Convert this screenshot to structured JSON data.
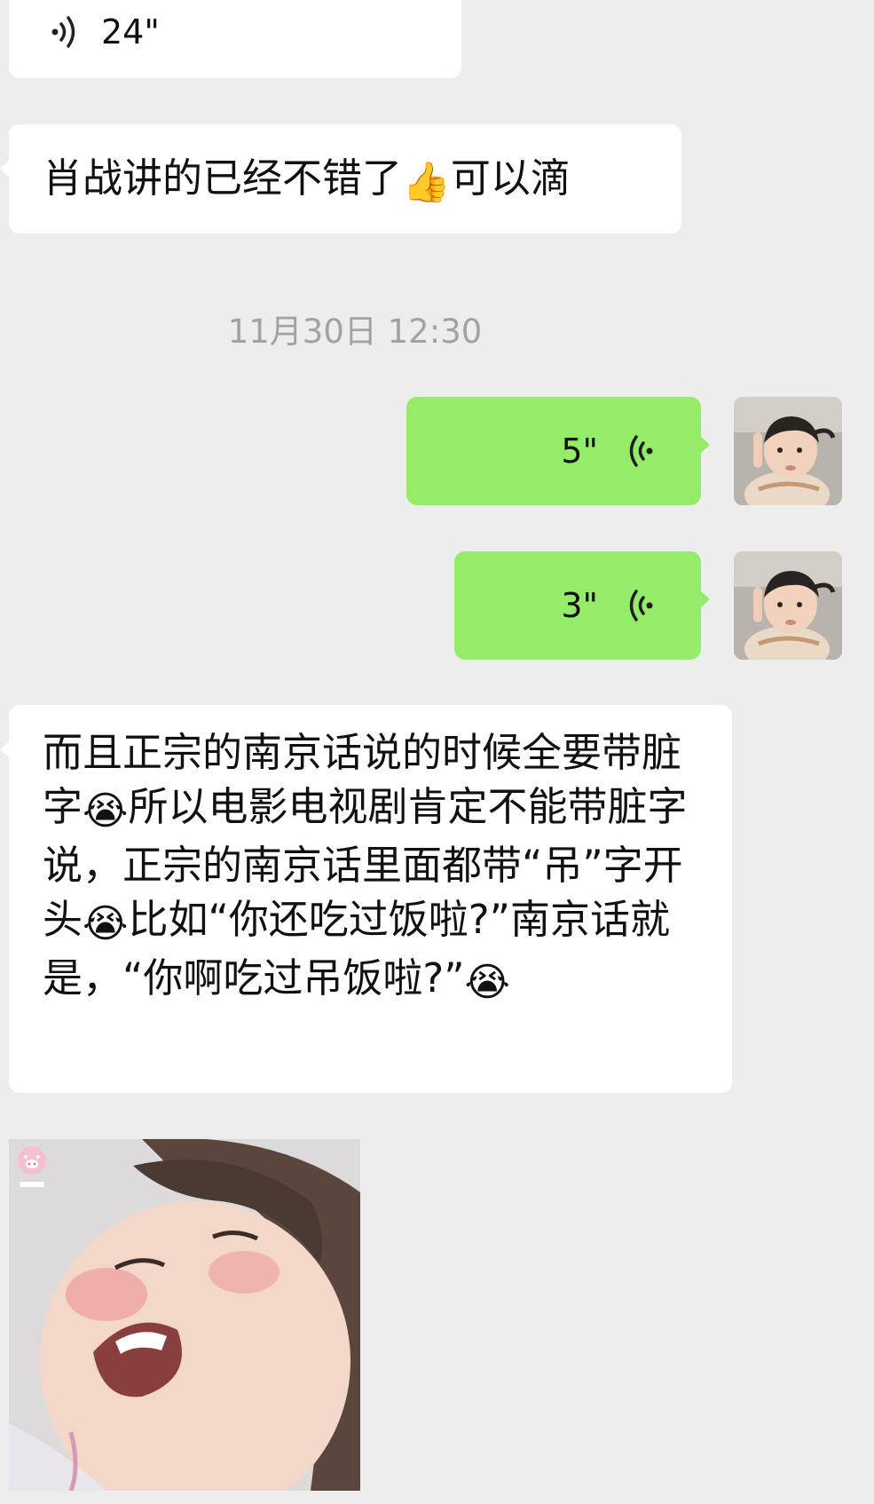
{
  "messages": [
    {
      "type": "voice",
      "side": "left",
      "duration": "24\""
    },
    {
      "type": "text",
      "side": "left",
      "text_before": "肖战讲的已经不错了",
      "emoji": "👍",
      "text_after": "可以滴"
    },
    {
      "type": "timestamp",
      "text": "11月30日 12:30"
    },
    {
      "type": "voice",
      "side": "right",
      "duration": "5\""
    },
    {
      "type": "voice",
      "side": "right",
      "duration": "3\""
    },
    {
      "type": "text",
      "side": "left",
      "segments": [
        "而且正宗的南京话说的时候全要带脏字",
        "😭",
        "所以电影电视剧肯定不能带脏字说，正宗的南京话里面都带“吊”字开头",
        "😭",
        "比如“你还吃过饭啦?”南京话就是，“你啊吃过吊饭啦?”",
        "😭"
      ]
    },
    {
      "type": "sticker",
      "side": "left",
      "icon": "crying-child-sticker"
    }
  ],
  "icons": {
    "voice_left": "voice-wave-icon",
    "voice_right": "voice-wave-icon",
    "avatar": "child-avatar",
    "emoji_thumbs": "thumbs-up-emoji",
    "emoji_cry": "loudly-crying-emoji"
  },
  "colors": {
    "background": "#ededed",
    "left_bubble": "#ffffff",
    "right_bubble": "#95ec69",
    "timestamp": "#a2a2a2"
  }
}
